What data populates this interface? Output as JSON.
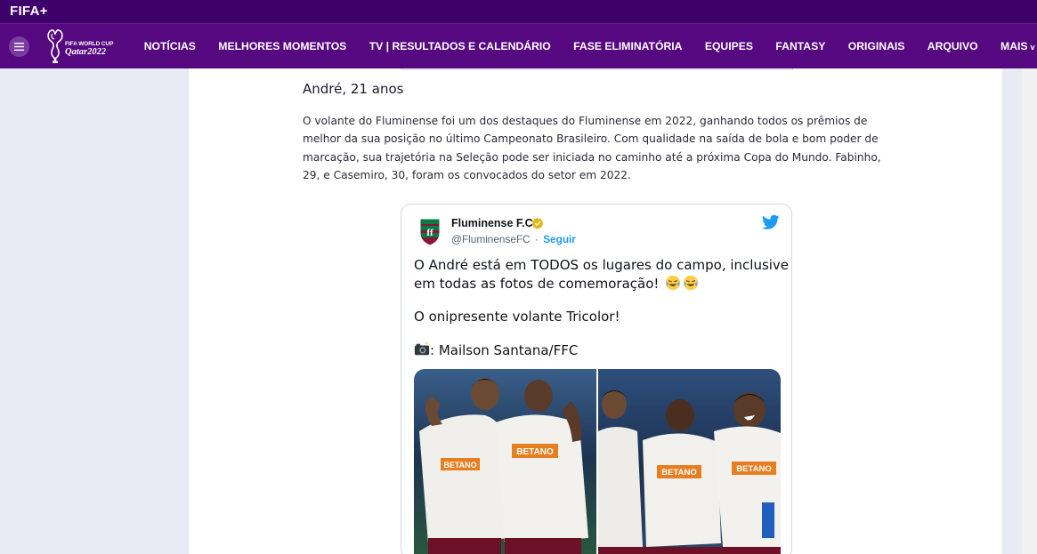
{
  "topbar": {
    "logo_text": "FIFA",
    "logo_plus": "+"
  },
  "navbar": {
    "wc_logo_line1": "FIFA WORLD CUP",
    "wc_logo_line2": "Qatar2022",
    "items": [
      {
        "label": "NOTÍCIAS"
      },
      {
        "label": "MELHORES MOMENTOS"
      },
      {
        "label": "TV | RESULTADOS E CALENDÁRIO"
      },
      {
        "label": "FASE ELIMINATÓRIA"
      },
      {
        "label": "EQUIPES"
      },
      {
        "label": "FANTASY"
      },
      {
        "label": "ORIGINAIS"
      },
      {
        "label": "ARQUIVO"
      }
    ],
    "more_label": "MAIS",
    "more_caret": "v"
  },
  "article": {
    "heading": "André, 21 anos",
    "paragraph": "O volante do Fluminense foi um dos destaques do Fluminense em 2022, ganhando todos os prêmios de melhor da sua posição no último Campeonato Brasileiro. Com qualidade na saída de bola e bom poder de marcação, sua trajetória na Seleção pode ser iniciada no caminho até a próxima Copa do Mundo. Fabinho, 29, e Casemiro, 30, foram os convocados do setor em 2022."
  },
  "tweet": {
    "author_name": "Fluminense F.C.",
    "handle": "@FluminenseFC",
    "separator": "·",
    "follow_label": "Seguir",
    "line1": "O André está em TODOS os lugares do campo, inclusive",
    "line2": "em todas as fotos de comemoração!",
    "line3": "O onipresente volante Tricolor!",
    "line4": ": Mailson Santana/FFC",
    "icons": {
      "verified": "verified-badge-icon",
      "bird": "twitter-bird-icon",
      "emoji_laugh": "tears-of-joy-emoji",
      "emoji_camera": "camera-flash-emoji"
    }
  },
  "colors": {
    "topbar": "#3e006b",
    "navbar": "#55087f",
    "twitter_blue": "#1d9bf0",
    "page_bg": "#e8ebf4"
  }
}
